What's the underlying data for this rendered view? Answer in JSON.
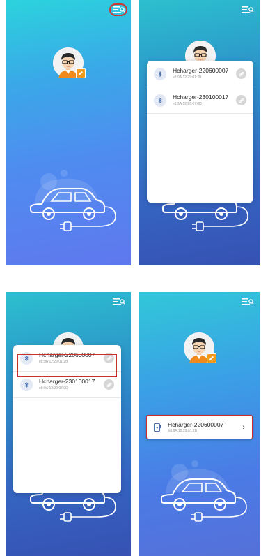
{
  "screens": [
    {
      "id": "home",
      "menu_icon": "menu-search-icon",
      "avatar_icon": "avatar-icon",
      "edit_icon": "edit-icon"
    },
    {
      "id": "device-list",
      "menu_icon": "menu-search-icon",
      "devices": [
        {
          "name": "Hcharger-220600007",
          "mac": "e8:9A:12:29:01:2B"
        },
        {
          "name": "Hcharger-230100017",
          "mac": "e8:9A:12:29:07:0D"
        }
      ]
    },
    {
      "id": "device-list-selected",
      "menu_icon": "menu-search-icon",
      "devices": [
        {
          "name": "Hcharger-220600007",
          "mac": "e8:9A:12:29:01:2B"
        },
        {
          "name": "Hcharger-230100017",
          "mac": "e8:9A:12:29:07:0D"
        }
      ]
    },
    {
      "id": "connected",
      "menu_icon": "menu-search-icon",
      "device": {
        "name": "Hcharger-220600007",
        "mac": "E8:9A:12:29:01:2B"
      }
    }
  ],
  "colors": {
    "highlight": "#d0352f",
    "edit_badge": "#f39a1e"
  }
}
